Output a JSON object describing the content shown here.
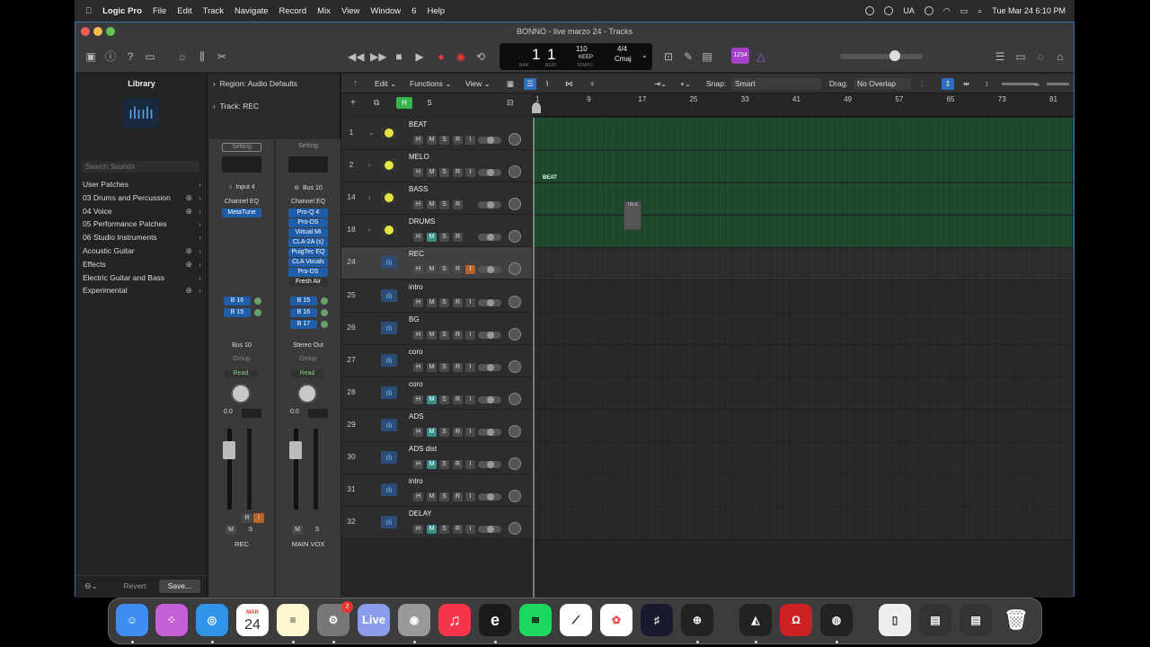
{
  "menubar": {
    "apple": "",
    "app": "Logic Pro",
    "items": [
      "File",
      "Edit",
      "Track",
      "Navigate",
      "Record",
      "Mix",
      "View",
      "Window",
      "6",
      "Help"
    ],
    "lang": "UA",
    "datetime": "Tue Mar 24  6:10 PM"
  },
  "window": {
    "title": "BONNO - live marzo 24 - Tracks"
  },
  "lcd": {
    "bar": "1",
    "beat": "1",
    "tempo": "110",
    "keep": "KEEP",
    "signature": "4/4",
    "key": "Cmaj",
    "lbl_bar": "BAR",
    "lbl_beat": "BEAT",
    "lbl_tempo": "TEMPO",
    "count_in": "1234"
  },
  "library": {
    "title": "Library",
    "search_placeholder": "Search Sounds",
    "items": [
      {
        "label": "User Patches",
        "plus": false
      },
      {
        "label": "03 Drums and Percussion",
        "plus": true
      },
      {
        "label": "04 Voice",
        "plus": true
      },
      {
        "label": "05 Performance Patches",
        "plus": false
      },
      {
        "label": "06 Studio Instruments",
        "plus": false
      },
      {
        "label": "Acoustic Guitar",
        "plus": true
      },
      {
        "label": "Effects",
        "plus": true
      },
      {
        "label": "Electric Guitar and Bass",
        "plus": false
      },
      {
        "label": "Experimental",
        "plus": true
      }
    ],
    "revert": "Revert",
    "save": "Save..."
  },
  "inspector": {
    "region": "Region: Audio Defaults",
    "track": "Track:  REC",
    "strip1": {
      "setting": "Setting",
      "input": "Input 4",
      "eq": "Channel EQ",
      "plugins": [
        "MetaTune"
      ],
      "sends": [
        "B 16",
        "B 15"
      ],
      "output": "Bus 10",
      "group": "Group",
      "auto": "Read",
      "vol": "0.0",
      "name": "REC",
      "m": "M",
      "s": "S",
      "r": "R",
      "i": "I"
    },
    "strip2": {
      "setting": "Setting",
      "input": "Bus 10",
      "eq": "Channel EQ",
      "plugins": [
        "Pro-Q 4",
        "Pro-DS",
        "Virtual Mi",
        "CLA-2A (s)",
        "PuigTec EQ",
        "CLA Vocals",
        "Pro-DS",
        "Fresh Air"
      ],
      "sends": [
        "B 15",
        "B 16",
        "B 17"
      ],
      "output": "Stereo Out",
      "group": "Group",
      "auto": "Read",
      "vol": "0.0",
      "name": "MAIN VOX",
      "m": "M",
      "s": "S"
    }
  },
  "tracks_toolbar": {
    "edit": "Edit",
    "functions": "Functions",
    "view": "View",
    "snap_label": "Snap:",
    "snap": "Smart",
    "drag_label": "Drag:",
    "drag": "No Overlap",
    "h": "H",
    "s": "S"
  },
  "ruler": {
    "ticks": [
      "1",
      "9",
      "17",
      "25",
      "33",
      "41",
      "49",
      "57",
      "65",
      "73",
      "81"
    ]
  },
  "tracks": [
    {
      "num": "1",
      "name": "BEAT",
      "kind": "stack",
      "btns": [
        "H",
        "M",
        "S",
        "R",
        "I"
      ],
      "disc": "⌄"
    },
    {
      "num": "2",
      "name": "MELO",
      "kind": "stack",
      "btns": [
        "H",
        "M",
        "S",
        "R",
        "I"
      ],
      "disc": "›"
    },
    {
      "num": "14",
      "name": "BASS",
      "kind": "stack",
      "btns": [
        "H",
        "M",
        "S",
        "R"
      ],
      "disc": "›"
    },
    {
      "num": "18",
      "name": "DRUMS",
      "kind": "stack",
      "btns": [
        "H",
        "M",
        "S",
        "R"
      ],
      "disc": "›",
      "mute": true
    },
    {
      "num": "24",
      "name": "REC",
      "kind": "audio",
      "btns": [
        "H",
        "M",
        "S",
        "R",
        "I"
      ],
      "sel": true,
      "rec": true
    },
    {
      "num": "25",
      "name": "intro",
      "kind": "audio",
      "btns": [
        "H",
        "M",
        "S",
        "R",
        "I"
      ]
    },
    {
      "num": "26",
      "name": "BG",
      "kind": "audio",
      "btns": [
        "H",
        "M",
        "S",
        "R",
        "I"
      ]
    },
    {
      "num": "27",
      "name": "coro",
      "kind": "audio",
      "btns": [
        "H",
        "M",
        "S",
        "R",
        "I"
      ]
    },
    {
      "num": "28",
      "name": "coro",
      "kind": "audio",
      "btns": [
        "H",
        "M",
        "S",
        "R",
        "I"
      ],
      "mute": true
    },
    {
      "num": "29",
      "name": "ADS",
      "kind": "audio",
      "btns": [
        "H",
        "M",
        "S",
        "R",
        "I"
      ],
      "mute": true
    },
    {
      "num": "30",
      "name": "ADS dist",
      "kind": "audio",
      "btns": [
        "H",
        "M",
        "S",
        "R",
        "I"
      ],
      "mute": true
    },
    {
      "num": "31",
      "name": "intro",
      "kind": "audio",
      "btns": [
        "H",
        "M",
        "S",
        "R",
        "I"
      ]
    },
    {
      "num": "32",
      "name": "DELAY",
      "kind": "audio",
      "btns": [
        "H",
        "M",
        "S",
        "R",
        "I"
      ],
      "mute": true
    }
  ],
  "regions": {
    "beat": "BEAT",
    "talk": "TALK"
  },
  "dock": {
    "calendar_month": "MAR",
    "calendar_day": "24",
    "badge": "2",
    "live": "Live"
  },
  "colors": {
    "accent": "#3c6ea8",
    "region_green": "#1e4a2e",
    "mute_teal": "#3b8e88",
    "rec_orange": "#b8642b"
  }
}
